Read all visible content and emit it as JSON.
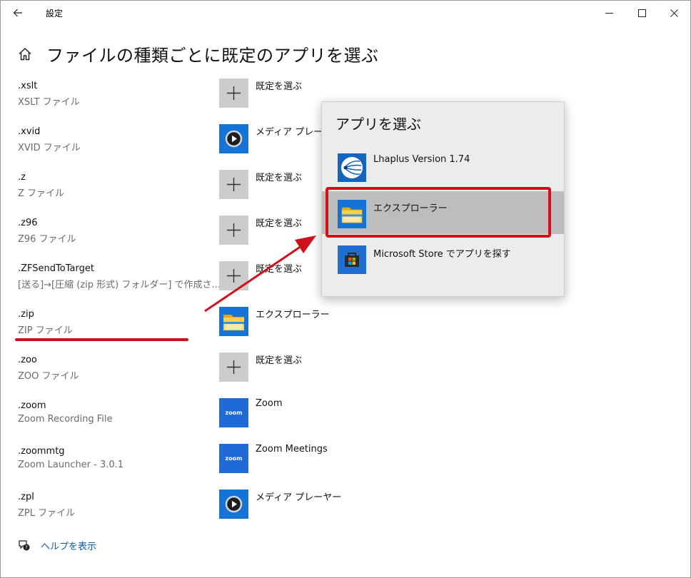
{
  "window": {
    "title": "設定",
    "controls": {
      "back_icon": "back-arrow-icon",
      "minimize_icon": "minimize-icon",
      "maximize_icon": "maximize-icon",
      "close_icon": "close-icon"
    }
  },
  "page": {
    "title": "ファイルの種類ごとに既定のアプリを選ぶ",
    "home_icon": "home-icon"
  },
  "rows": [
    {
      "ext": ".xslt",
      "desc": "XSLT ファイル",
      "app": "既定を選ぶ",
      "icon": "plus"
    },
    {
      "ext": ".xvid",
      "desc": "XVID ファイル",
      "app": "メディア プレーヤー",
      "icon": "media-player"
    },
    {
      "ext": ".z",
      "desc": "Z ファイル",
      "app": "既定を選ぶ",
      "icon": "plus"
    },
    {
      "ext": ".z96",
      "desc": "Z96 ファイル",
      "app": "既定を選ぶ",
      "icon": "plus"
    },
    {
      "ext": ".ZFSendToTarget",
      "desc": "[送る]→[圧縮 (zip 形式) フォルダー] で作成さ...",
      "app": "既定を選ぶ",
      "icon": "plus"
    },
    {
      "ext": ".zip",
      "desc": "ZIP ファイル",
      "app": "エクスプローラー",
      "icon": "file-explorer"
    },
    {
      "ext": ".zoo",
      "desc": "ZOO ファイル",
      "app": "既定を選ぶ",
      "icon": "plus"
    },
    {
      "ext": ".zoom",
      "desc": "Zoom Recording File",
      "app": "Zoom",
      "icon": "zoom"
    },
    {
      "ext": ".zoommtg",
      "desc": "Zoom Launcher - 3.0.1",
      "app": "Zoom Meetings",
      "icon": "zoom"
    },
    {
      "ext": ".zpl",
      "desc": "ZPL ファイル",
      "app": "メディア プレーヤー",
      "icon": "media-player"
    }
  ],
  "zoom_icon_text": "zoom",
  "help": {
    "label": "ヘルプを表示",
    "icon": "help-chat-icon"
  },
  "flyout": {
    "title": "アプリを選ぶ",
    "items": [
      {
        "label": "Lhaplus Version 1.74",
        "icon": "lhaplus-icon",
        "selected": false
      },
      {
        "label": "エクスプローラー",
        "icon": "file-explorer-icon",
        "selected": true
      },
      {
        "label": "Microsoft Store でアプリを探す",
        "icon": "microsoft-store-icon",
        "selected": false
      }
    ]
  },
  "colors": {
    "accent": "#1473d6",
    "link": "#0b5cad",
    "annotation_red": "#d0111b",
    "selected_bg": "#bdbdbd",
    "flyout_bg": "#ececec"
  }
}
